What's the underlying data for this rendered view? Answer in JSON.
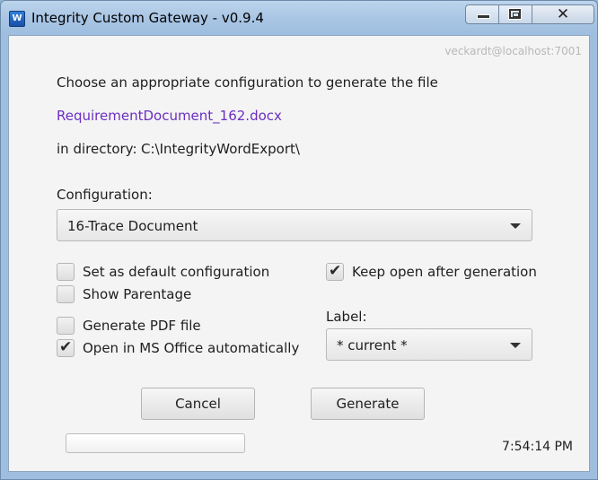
{
  "window": {
    "title": "Integrity Custom Gateway - v0.9.4",
    "icon": "app-logo-icon",
    "icon_letter": "W",
    "controls": {
      "minimize": "minimize-icon",
      "maximize": "maximize-icon",
      "close": "✕"
    }
  },
  "header": {
    "user": "veckardt@localhost:7001"
  },
  "intro": {
    "prompt": "Choose an appropriate configuration to generate the file",
    "filename": "RequirementDocument_162.docx",
    "dir_label": "in directory:",
    "dir_value": "C:\\IntegrityWordExport\\"
  },
  "configuration": {
    "label": "Configuration:",
    "selected": "16-Trace Document"
  },
  "options": {
    "set_default": {
      "label": "Set as default configuration",
      "checked": false
    },
    "show_parentage": {
      "label": "Show Parentage",
      "checked": false
    },
    "generate_pdf": {
      "label": "Generate PDF file",
      "checked": false
    },
    "open_office": {
      "label": "Open in MS Office automatically",
      "checked": true
    },
    "keep_open": {
      "label": "Keep open after generation",
      "checked": true
    }
  },
  "label_field": {
    "label": "Label:",
    "selected": "* current *"
  },
  "buttons": {
    "cancel": "Cancel",
    "generate": "Generate"
  },
  "progress": {
    "value": 0
  },
  "status": {
    "time": "7:54:14 PM"
  },
  "colors": {
    "filename": "#6b2fc0",
    "progress_fill": "#58a0e8"
  }
}
